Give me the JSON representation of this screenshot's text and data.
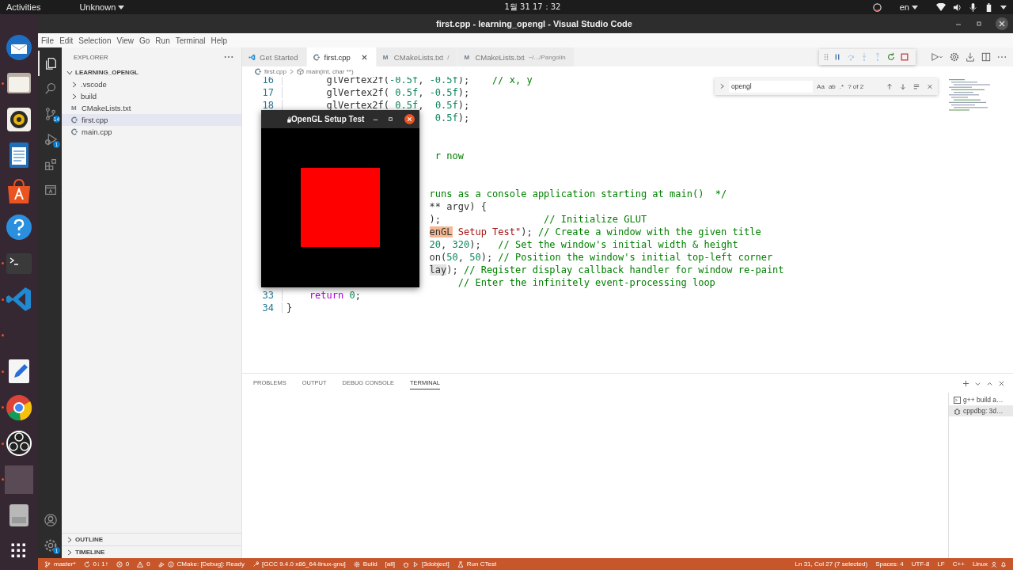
{
  "top_bar": {
    "activities": "Activities",
    "app_menu": "Unknown",
    "clock": "1월 31  17：32",
    "language": "en"
  },
  "dock": [
    {
      "kind": "mail",
      "running": false
    },
    {
      "kind": "files",
      "running": true
    },
    {
      "kind": "music",
      "running": false
    },
    {
      "kind": "writer",
      "running": false
    },
    {
      "kind": "software",
      "running": false
    },
    {
      "kind": "help",
      "running": false
    },
    {
      "kind": "terminal",
      "running": true
    },
    {
      "kind": "code",
      "running": true
    },
    {
      "kind": "empty",
      "running": true
    },
    {
      "kind": "editor",
      "running": true
    },
    {
      "kind": "browser",
      "running": true
    },
    {
      "kind": "recorder",
      "running": true
    },
    {
      "kind": "window",
      "running": true
    },
    {
      "kind": "drive",
      "running": false
    }
  ],
  "window": {
    "title": "first.cpp - learning_opengl - Visual Studio Code"
  },
  "menu": [
    "File",
    "Edit",
    "Selection",
    "View",
    "Go",
    "Run",
    "Terminal",
    "Help"
  ],
  "activity_bar": [
    {
      "kind": "explorer",
      "selected": true
    },
    {
      "kind": "search",
      "selected": false
    },
    {
      "kind": "source_control",
      "selected": false,
      "badge": "14"
    },
    {
      "kind": "run_debug",
      "selected": false,
      "badge": "1"
    },
    {
      "kind": "extensions",
      "selected": false
    },
    {
      "kind": "remote",
      "selected": false
    }
  ],
  "activity_bar_bottom": [
    {
      "kind": "account"
    },
    {
      "kind": "settings",
      "badge": "1"
    }
  ],
  "sidebar": {
    "title": "EXPLORER",
    "root": {
      "label": "LEARNING_OPENGL",
      "expanded": true,
      "children": [
        {
          "kind": "folder",
          "label": ".vscode",
          "expanded": false,
          "selected": false
        },
        {
          "kind": "folder",
          "label": "build",
          "expanded": false,
          "selected": false
        },
        {
          "kind": "cmake",
          "icon": "M",
          "label": "CMakeLists.txt",
          "selected": false
        },
        {
          "kind": "cpp",
          "label": "first.cpp",
          "selected": true
        },
        {
          "kind": "cpp",
          "label": "main.cpp",
          "selected": false
        }
      ]
    },
    "sections": [
      {
        "label": "OUTLINE",
        "expanded": false
      },
      {
        "label": "TIMELINE",
        "expanded": false
      }
    ]
  },
  "tabs": [
    {
      "kind": "welcome",
      "label": "Get Started",
      "selected": false
    },
    {
      "kind": "cpp",
      "label": "first.cpp",
      "selected": true
    },
    {
      "kind": "cmake",
      "icon": "M",
      "label": "CMakeLists.txt",
      "description": "/",
      "selected": false
    },
    {
      "kind": "cmake",
      "icon": "M",
      "label": "CMakeLists.txt",
      "description": "~/.../Pangolin",
      "selected": false
    }
  ],
  "debug_toolbar": [
    {
      "kind": "pause",
      "disabled": false
    },
    {
      "kind": "step_over",
      "disabled": true
    },
    {
      "kind": "step_into",
      "disabled": true
    },
    {
      "kind": "step_out",
      "disabled": true
    },
    {
      "kind": "restart",
      "disabled": false
    },
    {
      "kind": "stop",
      "disabled": false
    }
  ],
  "breadcrumb": [
    {
      "kind": "file",
      "label": "first.cpp"
    },
    {
      "kind": "symbol",
      "label": "main(int, char **)"
    }
  ],
  "find": {
    "value": "opengl",
    "toggles": [
      "Aa",
      "ab",
      ".*"
    ],
    "result": "? of 2"
  },
  "lines": [
    {
      "kind": "code",
      "number": "16",
      "segments": [
        {
          "kind": "code",
          "text": "       glVertex2f("
        },
        {
          "kind": "number",
          "text": "-0.5f"
        },
        {
          "kind": "code",
          "text": ", "
        },
        {
          "kind": "number",
          "text": "-0.5f"
        },
        {
          "kind": "code",
          "text": ");    "
        },
        {
          "kind": "comment",
          "text": "// x, y"
        }
      ]
    },
    {
      "kind": "code",
      "number": "17",
      "segments": [
        {
          "kind": "code",
          "text": "       glVertex2f( "
        },
        {
          "kind": "number",
          "text": "0.5f"
        },
        {
          "kind": "code",
          "text": ", "
        },
        {
          "kind": "number",
          "text": "-0.5f"
        },
        {
          "kind": "code",
          "text": ");"
        }
      ]
    },
    {
      "kind": "code",
      "number": "18",
      "segments": [
        {
          "kind": "code",
          "text": "       glVertex2f( "
        },
        {
          "kind": "number",
          "text": "0.5f"
        },
        {
          "kind": "code",
          "text": ",  "
        },
        {
          "kind": "number",
          "text": "0.5f"
        },
        {
          "kind": "code",
          "text": ");"
        }
      ]
    },
    {
      "kind": "partial",
      "segments": [
        {
          "kind": "number",
          "text": " 0.5f"
        },
        {
          "kind": "code",
          "text": ");"
        }
      ]
    },
    {
      "kind": "blank"
    },
    {
      "kind": "blank"
    },
    {
      "kind": "partial",
      "segments": [
        {
          "kind": "comment",
          "text": " r now"
        }
      ]
    },
    {
      "kind": "blank"
    },
    {
      "kind": "blank"
    },
    {
      "kind": "partial",
      "segments": [
        {
          "kind": "comment",
          "text": "runs as a console application starting at main()  */"
        }
      ]
    },
    {
      "kind": "partial",
      "segments": [
        {
          "kind": "code",
          "text": "** argv) {"
        }
      ]
    },
    {
      "kind": "partial",
      "segments": [
        {
          "kind": "code",
          "text": ");                  "
        },
        {
          "kind": "comment",
          "text": "// Initialize GLUT"
        }
      ]
    },
    {
      "kind": "partial",
      "segments": [
        {
          "kind": "match",
          "text": "enGL"
        },
        {
          "kind": "string",
          "text": " Setup Test\""
        },
        {
          "kind": "code",
          "text": "); "
        },
        {
          "kind": "comment",
          "text": "// Create a window with the given title"
        }
      ]
    },
    {
      "kind": "partial",
      "segments": [
        {
          "kind": "number",
          "text": "20"
        },
        {
          "kind": "code",
          "text": ", "
        },
        {
          "kind": "number",
          "text": "320"
        },
        {
          "kind": "code",
          "text": ");   "
        },
        {
          "kind": "comment",
          "text": "// Set the window's initial width & height"
        }
      ]
    },
    {
      "kind": "partial",
      "segments": [
        {
          "kind": "code",
          "text": "on("
        },
        {
          "kind": "number",
          "text": "50"
        },
        {
          "kind": "code",
          "text": ", "
        },
        {
          "kind": "number",
          "text": "50"
        },
        {
          "kind": "code",
          "text": "); "
        },
        {
          "kind": "comment",
          "text": "// Position the window's initial top-left corner"
        }
      ]
    },
    {
      "kind": "partial",
      "segments": [
        {
          "kind": "selection",
          "text": "lay"
        },
        {
          "kind": "code",
          "text": "); "
        },
        {
          "kind": "comment",
          "text": "// Register display callback handler for window re-paint"
        }
      ]
    },
    {
      "kind": "partial",
      "segments": [
        {
          "kind": "comment",
          "text": "     // Enter the infinitely event-processing loop"
        }
      ]
    },
    {
      "kind": "code",
      "number": "33",
      "segments": [
        {
          "kind": "keyword",
          "text": "    return"
        },
        {
          "kind": "number",
          "text": " 0"
        },
        {
          "kind": "code",
          "text": ";"
        }
      ]
    },
    {
      "kind": "code",
      "number": "34",
      "segments": [
        {
          "kind": "code",
          "text": "}"
        }
      ]
    }
  ],
  "gl_window": {
    "title": "OpenGL Setup Test"
  },
  "panel": {
    "tabs": [
      {
        "label": "PROBLEMS",
        "selected": false
      },
      {
        "label": "OUTPUT",
        "selected": false
      },
      {
        "label": "DEBUG CONSOLE",
        "selected": false
      },
      {
        "label": "TERMINAL",
        "selected": true
      }
    ],
    "terminals": [
      {
        "kind": "task",
        "label": "g++ build a…",
        "selected": false
      },
      {
        "kind": "debug",
        "label": "cppdbg: 3d…",
        "selected": true
      }
    ]
  },
  "status_bar": {
    "left": [
      {
        "kind": "branch",
        "label": "master*"
      },
      {
        "kind": "sync",
        "label": "0↓ 1↑"
      },
      {
        "kind": "errors",
        "label": "0"
      },
      {
        "kind": "warnings",
        "label": "0"
      },
      {
        "kind": "launch"
      },
      {
        "kind": "info",
        "label": "CMake: [Debug]: Ready"
      },
      {
        "kind": "kit",
        "label": "[GCC 9.4.0 x86_64-linux-gnu]"
      },
      {
        "kind": "build",
        "label": "Build"
      },
      {
        "kind": "text",
        "label": "[all]"
      },
      {
        "kind": "debug"
      },
      {
        "kind": "run"
      },
      {
        "kind": "text",
        "label": "[3dobject]"
      },
      {
        "kind": "ctest",
        "label": "Run CTest"
      }
    ],
    "right": [
      {
        "kind": "text",
        "label": "Ln 31, Col 27 (7 selected)"
      },
      {
        "kind": "text",
        "label": "Spaces: 4"
      },
      {
        "kind": "text",
        "label": "UTF-8"
      },
      {
        "kind": "text",
        "label": "LF"
      },
      {
        "kind": "text",
        "label": "C++"
      },
      {
        "kind": "text",
        "label": "Linux"
      },
      {
        "kind": "account"
      },
      {
        "kind": "bell"
      }
    ]
  }
}
